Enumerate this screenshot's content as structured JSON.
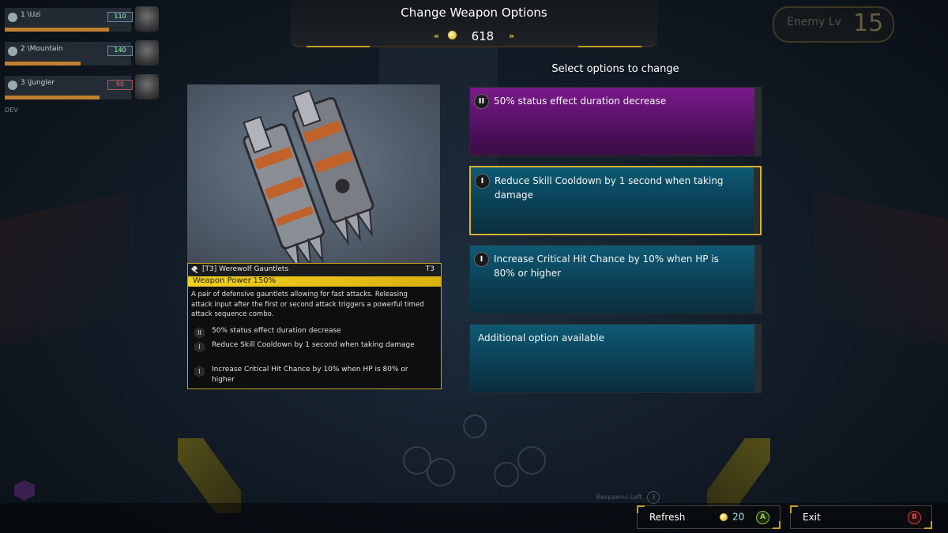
{
  "header": {
    "title": "Change Weapon Options",
    "currency": "618"
  },
  "enemy": {
    "label": "Enemy Lv",
    "level": "15"
  },
  "party": [
    {
      "name": "1 \\Uzi",
      "level": "110",
      "hp": 0.82
    },
    {
      "name": "2 \\Mountain",
      "level": "140",
      "hp": 0.6
    },
    {
      "name": "3 \\Jungler",
      "level": "50",
      "hp": 0.75
    }
  ],
  "dev_tag": "DEV",
  "weapon": {
    "name": "[T3] Werewolf Gauntlets",
    "tier": "T3",
    "power_label": "Weapon Power",
    "power_value": ": 150%",
    "description": "A pair of defensive gauntlets allowing for fast attacks. Releasing attack input after the first or second attack triggers a powerful timed attack sequence combo.",
    "options": [
      {
        "icon": "II",
        "text": "50% status effect duration decrease"
      },
      {
        "icon": "I",
        "text": "Reduce Skill Cooldown by 1 second when taking damage"
      },
      {
        "icon": "I",
        "text": "Increase Critical Hit Chance by 10% when HP is 80% or higher"
      }
    ]
  },
  "options_panel": {
    "title": "Select options to change",
    "cards": [
      {
        "icon": "II",
        "text": "50% status effect duration decrease",
        "color": "#7a1a8a"
      },
      {
        "icon": "I",
        "text": "Reduce Skill Cooldown by 1 second when taking damage",
        "color": "#0e5a74",
        "selected": true
      },
      {
        "icon": "I",
        "text": "Increase Critical Hit Chance by 10% when HP is 80% or higher",
        "color": "#0e5a74"
      },
      {
        "text": "Additional option available",
        "color": "#0e5a74"
      }
    ]
  },
  "respawn": {
    "label": "Respawns Left",
    "count": "3"
  },
  "footer": {
    "refresh_label": "Refresh",
    "refresh_cost": "20",
    "refresh_key": "A",
    "exit_label": "Exit",
    "exit_key": "B"
  },
  "colors": {
    "accent": "#c9a020",
    "power_bar": "#f2d020",
    "purple_option": "#7a1a8a",
    "blue_option": "#0e5a74"
  }
}
